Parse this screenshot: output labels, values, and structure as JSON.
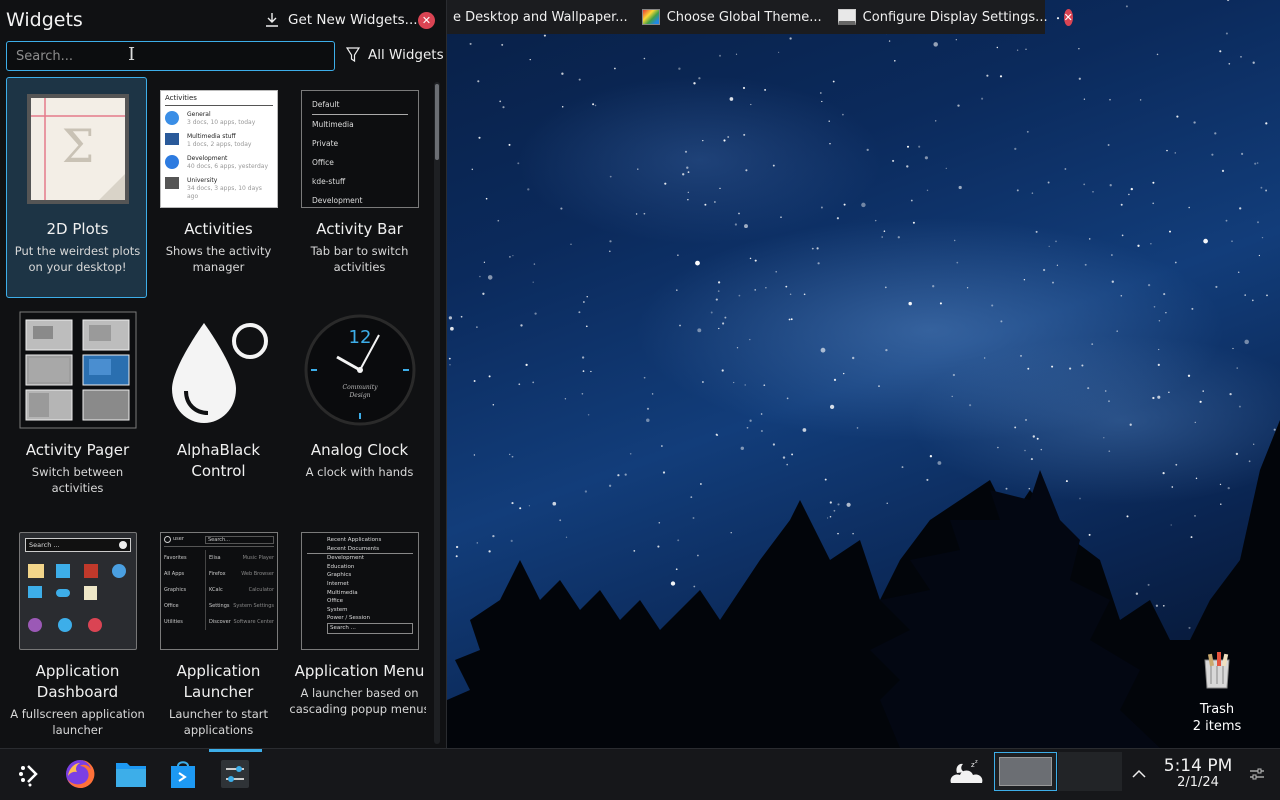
{
  "top_strip": {
    "items": [
      {
        "label": "e Desktop and Wallpaper..."
      },
      {
        "label": "Choose Global Theme..."
      },
      {
        "label": "Configure Display Settings..."
      }
    ]
  },
  "panel": {
    "title": "Widgets",
    "get_new_label": "Get New Widgets...",
    "search_placeholder": "Search...",
    "filter_label": "All Widgets"
  },
  "widgets": [
    {
      "name": "2D Plots",
      "desc": "Put the weirdest plots on your desktop!",
      "selected": true
    },
    {
      "name": "Activities",
      "desc": "Shows the activity manager"
    },
    {
      "name": "Activity Bar",
      "desc": "Tab bar to switch activities"
    },
    {
      "name": "Activity Pager",
      "desc": "Switch between activities"
    },
    {
      "name": "AlphaBlack Control",
      "desc": ""
    },
    {
      "name": "Analog Clock",
      "desc": "A clock with hands"
    },
    {
      "name": "Application Dashboard",
      "desc": "A fullscreen application launcher"
    },
    {
      "name": "Application Launcher",
      "desc": "Launcher to start applications"
    },
    {
      "name": "Application Menu",
      "desc": "A launcher based on cascading popup menus"
    }
  ],
  "thumbs": {
    "activities": {
      "header": "Activities",
      "rows": [
        {
          "title": "General",
          "sub": "3 docs, 10 apps, today"
        },
        {
          "title": "Multimedia stuff",
          "sub": "1 docs, 2 apps, today"
        },
        {
          "title": "Development",
          "sub": "40 docs, 6 apps, yesterday"
        },
        {
          "title": "University",
          "sub": "34 docs, 3 apps, 10 days ago"
        }
      ]
    },
    "activity_bar": [
      "Default",
      "Multimedia",
      "Private",
      "Office",
      "kde-stuff",
      "Development"
    ],
    "clock_number": "12",
    "clock_brand": [
      "Community",
      "Design"
    ],
    "dashboard_search": "Search ...",
    "launcher": {
      "user": "user",
      "search": "Search...",
      "cats": [
        "Favorites",
        "All Apps",
        "Graphics",
        "Office",
        "Utilities"
      ],
      "apps": [
        "Elisa",
        "Firefox",
        "KCalc",
        "Settings",
        "Discover"
      ],
      "subs": [
        "Music Player",
        "Web Browser",
        "Calculator",
        "System Settings",
        "Software Center"
      ]
    },
    "appmenu": {
      "top": [
        "Recent Applications",
        "Recent Documents"
      ],
      "items": [
        "Development",
        "Education",
        "Graphics",
        "Internet",
        "Multimedia",
        "Office",
        "System"
      ],
      "power": "Power / Session",
      "search": "Search ..."
    }
  },
  "desktop": {
    "trash_label": "Trash",
    "trash_count": "2 items"
  },
  "taskbar": {
    "time": "5:14 PM",
    "date": "2/1/24"
  },
  "colors": {
    "accent": "#3daee9",
    "close": "#da4453",
    "panel_bg": "#101113",
    "taskbar_bg": "#16171a"
  },
  "icons": {
    "launcher": "kde-launcher-icon",
    "browser": "firefox-icon",
    "files": "folder-icon",
    "store": "discover-icon",
    "settings": "system-settings-icon",
    "weather": "night-weather-icon",
    "tray_expand": "chevron-up-icon",
    "panel_config": "panel-config-icon"
  }
}
